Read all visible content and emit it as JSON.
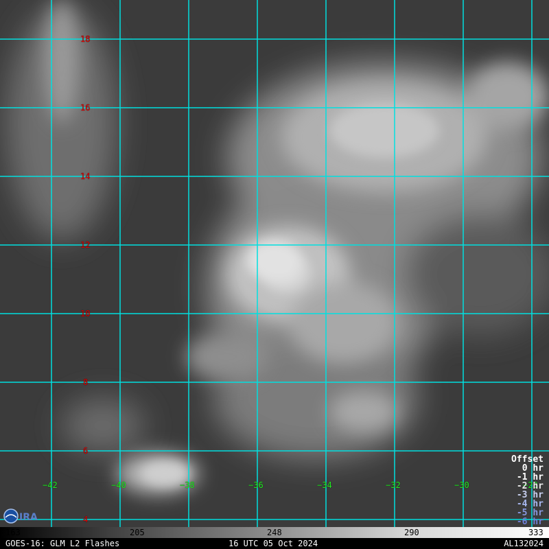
{
  "map": {
    "grid_color": "#00e0e0",
    "latitudes": [
      {
        "label": "18"
      },
      {
        "label": "16"
      },
      {
        "label": "14"
      },
      {
        "label": "12"
      },
      {
        "label": "10"
      },
      {
        "label": "8"
      },
      {
        "label": "6"
      },
      {
        "label": "4"
      }
    ],
    "longitudes": [
      {
        "label": "−42"
      },
      {
        "label": "−40"
      },
      {
        "label": "−38"
      },
      {
        "label": "−36"
      },
      {
        "label": "−34"
      },
      {
        "label": "−32"
      },
      {
        "label": "−30"
      },
      {
        "label": "−28"
      }
    ]
  },
  "offset_legend": {
    "title": "Offset",
    "items": [
      {
        "label": "0 hr",
        "color": "#ffffff"
      },
      {
        "label": "-1 hr",
        "color": "#ffffff"
      },
      {
        "label": "-2 hr",
        "color": "#e8e8e8"
      },
      {
        "label": "-3 hr",
        "color": "#c8d0f0"
      },
      {
        "label": "-4 hr",
        "color": "#a8b8f0"
      },
      {
        "label": "-5 hr",
        "color": "#8898e0"
      },
      {
        "label": "-6 hr",
        "color": "#7080d8"
      }
    ]
  },
  "colorbar": {
    "ticks": [
      "163",
      "205",
      "248",
      "290",
      "333"
    ]
  },
  "footer": {
    "left": "GOES-16: GLM L2 Flashes",
    "center": "16 UTC 05 Oct 2024",
    "right": "AL132024"
  }
}
